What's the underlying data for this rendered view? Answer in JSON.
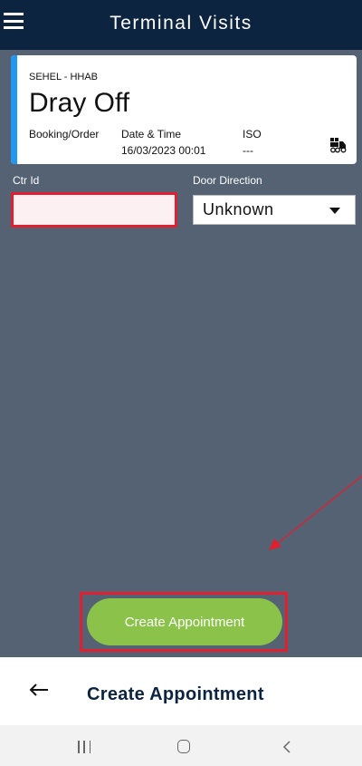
{
  "header": {
    "title": "Terminal Visits",
    "menu_icon": "hamburger-menu-icon"
  },
  "visit_card": {
    "terminal": "SEHEL - HHAB",
    "visit_type": "Dray Off",
    "booking_label": "Booking/Order",
    "datetime_label": "Date & Time",
    "datetime_value": "16/03/2023 00:01",
    "iso_label": "ISO",
    "iso_value": "---",
    "accent_color": "#2196f3",
    "icon": "forklift-truck-icon"
  },
  "form": {
    "ctr_id_label": "Ctr Id",
    "ctr_id_value": "",
    "door_direction_label": "Door Direction",
    "door_direction_value": "Unknown"
  },
  "actions": {
    "create_label": "Create Appointment",
    "button_color": "#8ac24a"
  },
  "bottom_bar": {
    "title": "Create Appointment",
    "back_icon": "back-arrow-icon"
  },
  "annotation_color": "#e0202f"
}
